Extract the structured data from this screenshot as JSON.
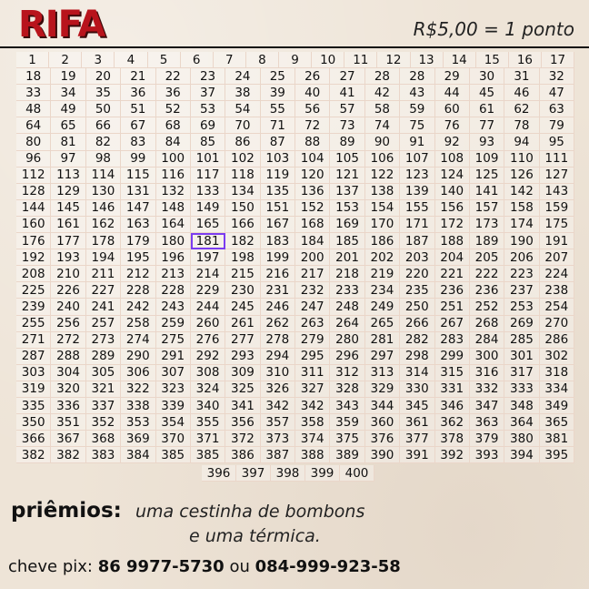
{
  "header": {
    "title": "RIFA",
    "price": "R$5,00 = 1 ponto"
  },
  "grid": {
    "rows": [
      [
        "1",
        "2",
        "3",
        "4",
        "5",
        "6",
        "7",
        "8",
        "9",
        "10",
        "11",
        "12",
        "13",
        "14",
        "15",
        "16",
        "17"
      ],
      [
        "18",
        "19",
        "20",
        "21",
        "22",
        "23",
        "24",
        "25",
        "26",
        "27",
        "28",
        "28",
        "29",
        "30",
        "31",
        "32"
      ],
      [
        "33",
        "34",
        "35",
        "36",
        "36",
        "37",
        "38",
        "39",
        "40",
        "41",
        "42",
        "43",
        "44",
        "45",
        "46",
        "47"
      ],
      [
        "48",
        "49",
        "50",
        "51",
        "52",
        "53",
        "54",
        "55",
        "56",
        "57",
        "58",
        "59",
        "60",
        "61",
        "62",
        "63"
      ],
      [
        "64",
        "65",
        "66",
        "67",
        "68",
        "69",
        "70",
        "71",
        "72",
        "73",
        "74",
        "75",
        "76",
        "77",
        "78",
        "79"
      ],
      [
        "80",
        "81",
        "82",
        "83",
        "84",
        "85",
        "86",
        "87",
        "88",
        "89",
        "90",
        "91",
        "92",
        "93",
        "94",
        "95"
      ],
      [
        "96",
        "97",
        "98",
        "99",
        "100",
        "101",
        "102",
        "103",
        "104",
        "105",
        "106",
        "107",
        "108",
        "109",
        "110",
        "111"
      ],
      [
        "112",
        "113",
        "114",
        "115",
        "116",
        "117",
        "118",
        "119",
        "120",
        "121",
        "122",
        "123",
        "124",
        "125",
        "126",
        "127"
      ],
      [
        "128",
        "129",
        "130",
        "131",
        "132",
        "133",
        "134",
        "135",
        "136",
        "137",
        "138",
        "139",
        "140",
        "141",
        "142",
        "143"
      ],
      [
        "144",
        "145",
        "146",
        "147",
        "148",
        "149",
        "150",
        "151",
        "152",
        "153",
        "154",
        "155",
        "156",
        "157",
        "158",
        "159"
      ],
      [
        "160",
        "161",
        "162",
        "163",
        "164",
        "165",
        "166",
        "167",
        "168",
        "169",
        "170",
        "171",
        "172",
        "173",
        "174",
        "175"
      ],
      [
        "176",
        "177",
        "178",
        "179",
        "180",
        "181",
        "182",
        "183",
        "184",
        "185",
        "186",
        "187",
        "188",
        "189",
        "190",
        "191"
      ],
      [
        "192",
        "193",
        "194",
        "195",
        "196",
        "197",
        "198",
        "199",
        "200",
        "201",
        "202",
        "203",
        "204",
        "205",
        "206",
        "207"
      ],
      [
        "208",
        "210",
        "211",
        "212",
        "213",
        "214",
        "215",
        "216",
        "217",
        "218",
        "219",
        "220",
        "221",
        "222",
        "223",
        "224"
      ],
      [
        "225",
        "226",
        "227",
        "228",
        "228",
        "229",
        "230",
        "231",
        "232",
        "233",
        "234",
        "235",
        "236",
        "236",
        "237",
        "238"
      ],
      [
        "239",
        "240",
        "241",
        "242",
        "243",
        "244",
        "245",
        "246",
        "247",
        "248",
        "249",
        "250",
        "251",
        "252",
        "253",
        "254"
      ],
      [
        "255",
        "256",
        "257",
        "258",
        "259",
        "260",
        "261",
        "262",
        "263",
        "264",
        "265",
        "266",
        "267",
        "268",
        "269",
        "270"
      ],
      [
        "271",
        "272",
        "273",
        "274",
        "275",
        "276",
        "277",
        "278",
        "279",
        "280",
        "281",
        "282",
        "283",
        "284",
        "285",
        "286"
      ],
      [
        "287",
        "288",
        "289",
        "290",
        "291",
        "292",
        "293",
        "294",
        "295",
        "296",
        "297",
        "298",
        "299",
        "300",
        "301",
        "302"
      ],
      [
        "303",
        "304",
        "305",
        "306",
        "307",
        "308",
        "309",
        "310",
        "311",
        "312",
        "313",
        "314",
        "315",
        "316",
        "317",
        "318"
      ],
      [
        "319",
        "320",
        "321",
        "322",
        "323",
        "324",
        "325",
        "326",
        "327",
        "328",
        "329",
        "330",
        "331",
        "332",
        "333",
        "334"
      ],
      [
        "335",
        "336",
        "337",
        "338",
        "339",
        "340",
        "341",
        "342",
        "342",
        "343",
        "344",
        "345",
        "346",
        "347",
        "348",
        "349"
      ],
      [
        "350",
        "351",
        "352",
        "353",
        "354",
        "355",
        "356",
        "357",
        "358",
        "359",
        "360",
        "361",
        "362",
        "363",
        "364",
        "365"
      ],
      [
        "366",
        "367",
        "368",
        "369",
        "370",
        "371",
        "372",
        "373",
        "374",
        "375",
        "376",
        "377",
        "378",
        "379",
        "380",
        "381"
      ],
      [
        "382",
        "382",
        "383",
        "384",
        "385",
        "385",
        "386",
        "387",
        "388",
        "389",
        "390",
        "391",
        "392",
        "393",
        "394",
        "395"
      ]
    ],
    "last_row": [
      "396",
      "397",
      "398",
      "399",
      "400"
    ],
    "highlighted": "181",
    "highlight_color": "#7b3cf0"
  },
  "prizes": {
    "label": "priêmios:",
    "line1": "uma cestinha de bombons",
    "line2": "e uma térmica."
  },
  "pix": {
    "label": "cheve pix:",
    "number1": "86 9977-5730",
    "separator": "ou",
    "number2": "084-999-923-58"
  },
  "colors": {
    "title": "#b8141c",
    "background": "#eee4d7"
  }
}
